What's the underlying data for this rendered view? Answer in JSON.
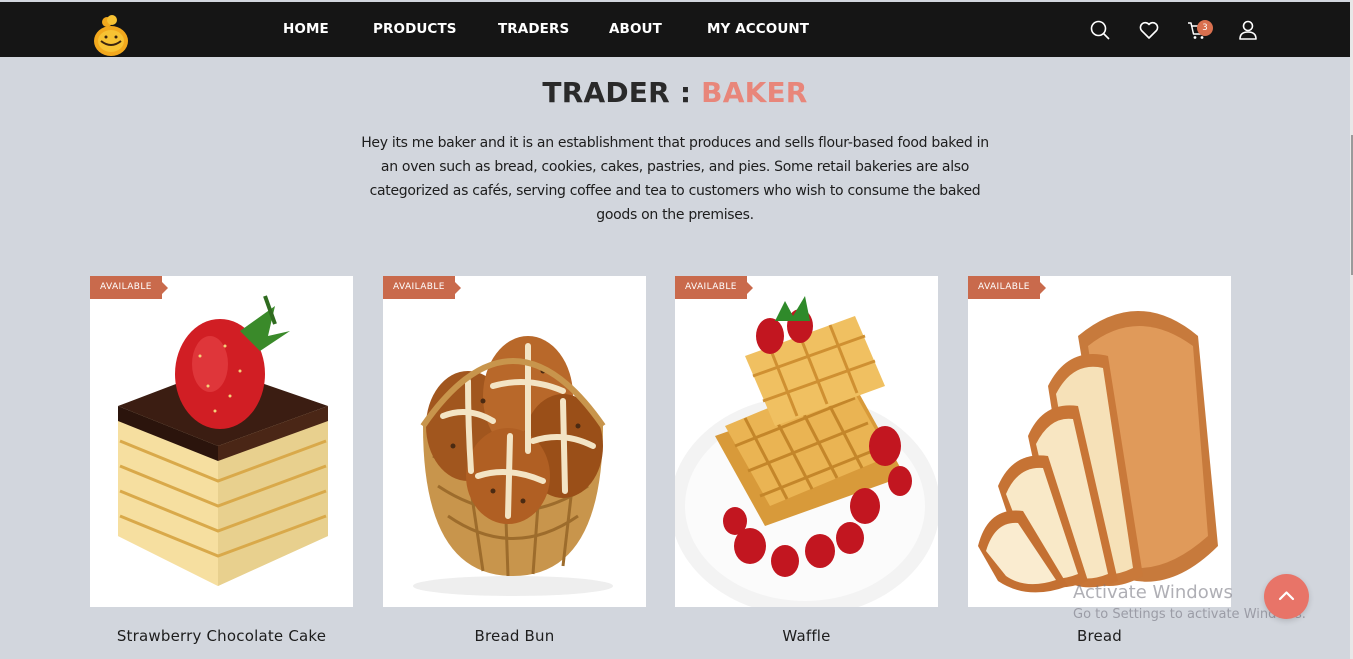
{
  "nav": {
    "items": [
      "HOME",
      "PRODUCTS",
      "TRADERS",
      "ABOUT",
      "MY ACCOUNT"
    ],
    "cart_count": "3",
    "icons": [
      "search-icon",
      "heart-icon",
      "cart-icon",
      "user-icon"
    ]
  },
  "page": {
    "title_prefix": "TRADER : ",
    "title_highlight": "BAKER",
    "description": "Hey its me baker and it is an establishment that produces and sells flour-based food baked in an oven such as bread, cookies, cakes, pastries, and pies. Some retail bakeries are also categorized as cafés, serving coffee and tea to customers who wish to consume the baked goods on the premises."
  },
  "colors": {
    "accent": "#e8867a",
    "badge": "#c96a4c",
    "nav_bg": "#151515",
    "page_bg": "#d2d6dd"
  },
  "products": [
    {
      "name": "Strawberry Chocolate Cake",
      "badge": "AVAILABLE"
    },
    {
      "name": "Bread Bun",
      "badge": "AVAILABLE"
    },
    {
      "name": "Waffle",
      "badge": "AVAILABLE"
    },
    {
      "name": "Bread",
      "badge": "AVAILABLE"
    }
  ],
  "watermark": {
    "line1": "Activate Windows",
    "line2": "Go to Settings to activate Windows."
  }
}
